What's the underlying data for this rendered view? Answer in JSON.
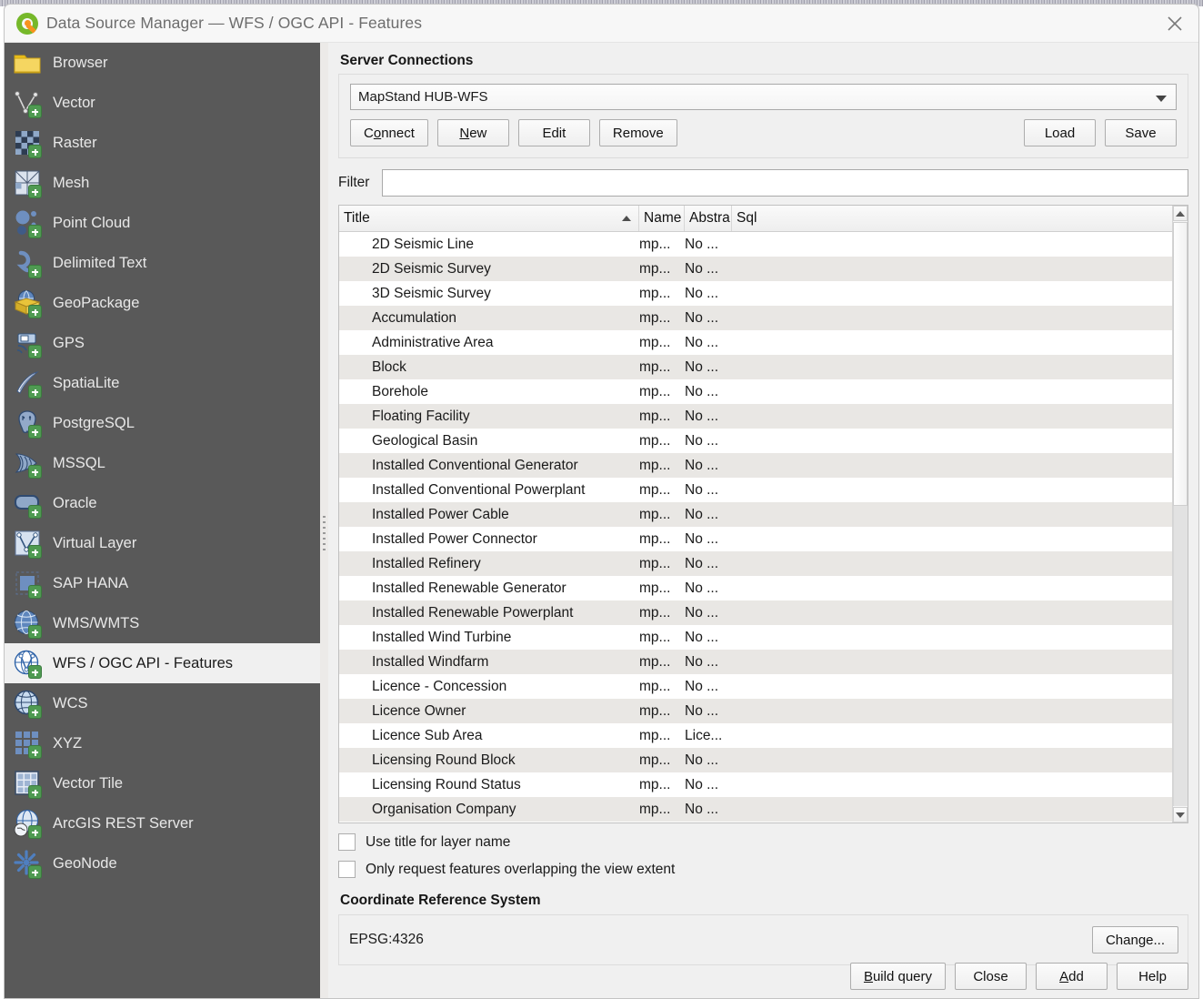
{
  "window": {
    "title": "Data Source Manager — WFS / OGC API - Features",
    "logo_icon": "qgis-logo-icon",
    "close_icon": "close-icon"
  },
  "sidebar": {
    "items": [
      {
        "label": "Browser",
        "icon": "folder-icon",
        "selected": false
      },
      {
        "label": "Vector",
        "icon": "vector-icon",
        "selected": false
      },
      {
        "label": "Raster",
        "icon": "raster-icon",
        "selected": false
      },
      {
        "label": "Mesh",
        "icon": "mesh-icon",
        "selected": false
      },
      {
        "label": "Point Cloud",
        "icon": "point-cloud-icon",
        "selected": false
      },
      {
        "label": "Delimited Text",
        "icon": "delimited-text-icon",
        "selected": false
      },
      {
        "label": "GeoPackage",
        "icon": "geopackage-icon",
        "selected": false
      },
      {
        "label": "GPS",
        "icon": "gps-icon",
        "selected": false
      },
      {
        "label": "SpatiaLite",
        "icon": "spatialite-icon",
        "selected": false
      },
      {
        "label": "PostgreSQL",
        "icon": "postgresql-icon",
        "selected": false
      },
      {
        "label": "MSSQL",
        "icon": "mssql-icon",
        "selected": false
      },
      {
        "label": "Oracle",
        "icon": "oracle-icon",
        "selected": false
      },
      {
        "label": "Virtual Layer",
        "icon": "virtual-layer-icon",
        "selected": false
      },
      {
        "label": "SAP HANA",
        "icon": "sap-hana-icon",
        "selected": false
      },
      {
        "label": "WMS/WMTS",
        "icon": "wms-wmts-icon",
        "selected": false
      },
      {
        "label": "WFS / OGC API - Features",
        "icon": "wfs-icon",
        "selected": true
      },
      {
        "label": "WCS",
        "icon": "wcs-icon",
        "selected": false
      },
      {
        "label": "XYZ",
        "icon": "xyz-icon",
        "selected": false
      },
      {
        "label": "Vector Tile",
        "icon": "vector-tile-icon",
        "selected": false
      },
      {
        "label": "ArcGIS REST Server",
        "icon": "arcgis-rest-icon",
        "selected": false
      },
      {
        "label": "GeoNode",
        "icon": "geonode-icon",
        "selected": false
      }
    ]
  },
  "server_connections": {
    "group_label": "Server Connections",
    "selected_connection": "MapStand HUB-WFS",
    "dropdown_icon": "chevron-down-icon",
    "buttons": {
      "connect": "Connect",
      "new": "New",
      "edit": "Edit",
      "remove": "Remove",
      "load": "Load",
      "save": "Save"
    }
  },
  "filter": {
    "label": "Filter",
    "value": "",
    "placeholder": ""
  },
  "table": {
    "columns": [
      "Title",
      "Name",
      "Abstra",
      "Sql"
    ],
    "sort_column": "Title",
    "sort_direction": "ascending",
    "sort_icon": "sort-ascending-icon",
    "rows": [
      {
        "title": "2D Seismic Line",
        "name": "mp...",
        "abstract": "No ...",
        "sql": ""
      },
      {
        "title": "2D Seismic Survey",
        "name": "mp...",
        "abstract": "No ...",
        "sql": ""
      },
      {
        "title": "3D Seismic Survey",
        "name": "mp...",
        "abstract": "No ...",
        "sql": ""
      },
      {
        "title": "Accumulation",
        "name": "mp...",
        "abstract": "No ...",
        "sql": ""
      },
      {
        "title": "Administrative Area",
        "name": "mp...",
        "abstract": "No ...",
        "sql": ""
      },
      {
        "title": "Block",
        "name": "mp...",
        "abstract": "No ...",
        "sql": ""
      },
      {
        "title": "Borehole",
        "name": "mp...",
        "abstract": "No ...",
        "sql": ""
      },
      {
        "title": "Floating Facility",
        "name": "mp...",
        "abstract": "No ...",
        "sql": ""
      },
      {
        "title": "Geological Basin",
        "name": "mp...",
        "abstract": "No ...",
        "sql": ""
      },
      {
        "title": "Installed Conventional Generator",
        "name": "mp...",
        "abstract": "No ...",
        "sql": ""
      },
      {
        "title": "Installed Conventional Powerplant",
        "name": "mp...",
        "abstract": "No ...",
        "sql": ""
      },
      {
        "title": "Installed Power Cable",
        "name": "mp...",
        "abstract": "No ...",
        "sql": ""
      },
      {
        "title": "Installed Power Connector",
        "name": "mp...",
        "abstract": "No ...",
        "sql": ""
      },
      {
        "title": "Installed Refinery",
        "name": "mp...",
        "abstract": "No ...",
        "sql": ""
      },
      {
        "title": "Installed Renewable Generator",
        "name": "mp...",
        "abstract": "No ...",
        "sql": ""
      },
      {
        "title": "Installed Renewable Powerplant",
        "name": "mp...",
        "abstract": "No ...",
        "sql": ""
      },
      {
        "title": "Installed Wind Turbine",
        "name": "mp...",
        "abstract": "No ...",
        "sql": ""
      },
      {
        "title": "Installed Windfarm",
        "name": "mp...",
        "abstract": "No ...",
        "sql": ""
      },
      {
        "title": "Licence - Concession",
        "name": "mp...",
        "abstract": "No ...",
        "sql": ""
      },
      {
        "title": "Licence Owner",
        "name": "mp...",
        "abstract": "No ...",
        "sql": ""
      },
      {
        "title": "Licence Sub Area",
        "name": "mp...",
        "abstract": "Lice...",
        "sql": ""
      },
      {
        "title": "Licensing Round Block",
        "name": "mp...",
        "abstract": "No ...",
        "sql": ""
      },
      {
        "title": "Licensing Round Status",
        "name": "mp...",
        "abstract": "No ...",
        "sql": ""
      },
      {
        "title": "Organisation Company",
        "name": "mp...",
        "abstract": "No ...",
        "sql": ""
      }
    ],
    "scrollbar": {
      "up_icon": "scroll-up-icon",
      "down_icon": "scroll-down-icon"
    }
  },
  "options": {
    "use_title_for_layer_name": {
      "label": "Use title for layer name",
      "checked": false
    },
    "only_request_overlapping": {
      "label": "Only request features overlapping the view extent",
      "checked": false
    }
  },
  "crs": {
    "group_label": "Coordinate Reference System",
    "value": "EPSG:4326",
    "change_button": "Change..."
  },
  "footer": {
    "build_query": "Build query",
    "close": "Close",
    "add": "Add",
    "help": "Help"
  },
  "colors": {
    "sidebar_bg": "#595959",
    "dialog_bg": "#f0f0f0",
    "selected_item_bg": "#f0f0f0",
    "row_alt_bg": "#e9e7e4",
    "accent_green": "#76b82a",
    "accent_orange": "#f7931e"
  }
}
